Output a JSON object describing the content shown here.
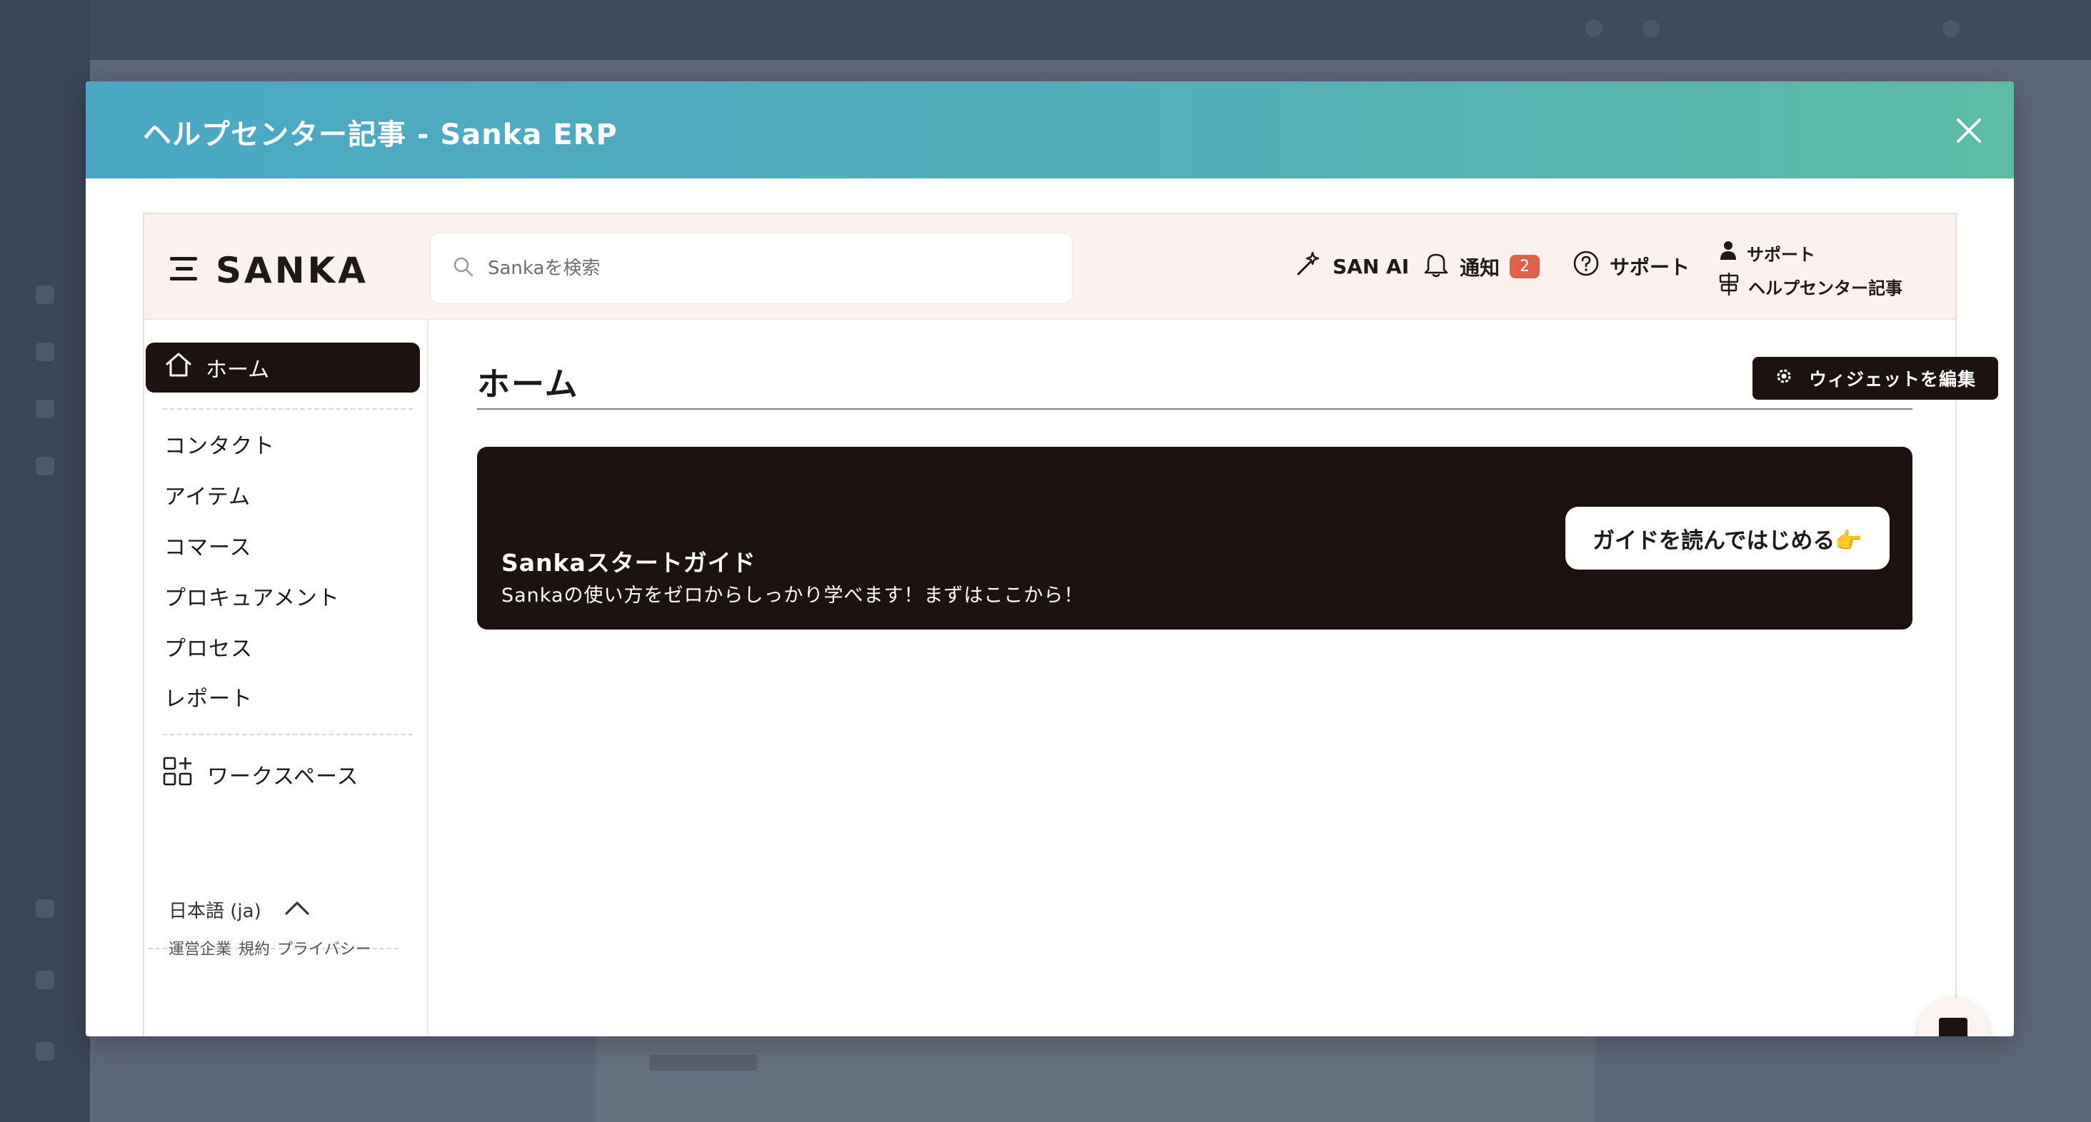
{
  "modal": {
    "title": "ヘルプセンター記事 - Sanka ERP"
  },
  "header": {
    "logo": "SANKA",
    "search_placeholder": "Sankaを検索",
    "san_ai": "SAN AI",
    "notifications": "通知",
    "notification_count": "2",
    "support": "サポート",
    "support_small": "サポート",
    "help_articles": "ヘルプセンター記事"
  },
  "sidebar": {
    "home": "ホーム",
    "items": [
      "コンタクト",
      "アイテム",
      "コマース",
      "プロキュアメント",
      "プロセス",
      "レポート"
    ],
    "workspace": "ワークスペース",
    "language": "日本語 (ja)",
    "footer": [
      "運営企業",
      "規約",
      "プライバシー"
    ]
  },
  "main": {
    "title": "ホーム",
    "edit_widgets": "ウィジェットを編集",
    "guide": {
      "title": "Sankaスタートガイド",
      "subtitle": "Sankaの使い方をゼロからしっかり学べます！まずはここから！",
      "button": "ガイドを読んではじめる👉"
    }
  },
  "colors": {
    "header_gradient_start": "#4aa8c4",
    "header_gradient_end": "#5cbca6",
    "dark": "#1c1311",
    "badge": "#e0614a",
    "app_header_bg": "#fbf2ef"
  }
}
